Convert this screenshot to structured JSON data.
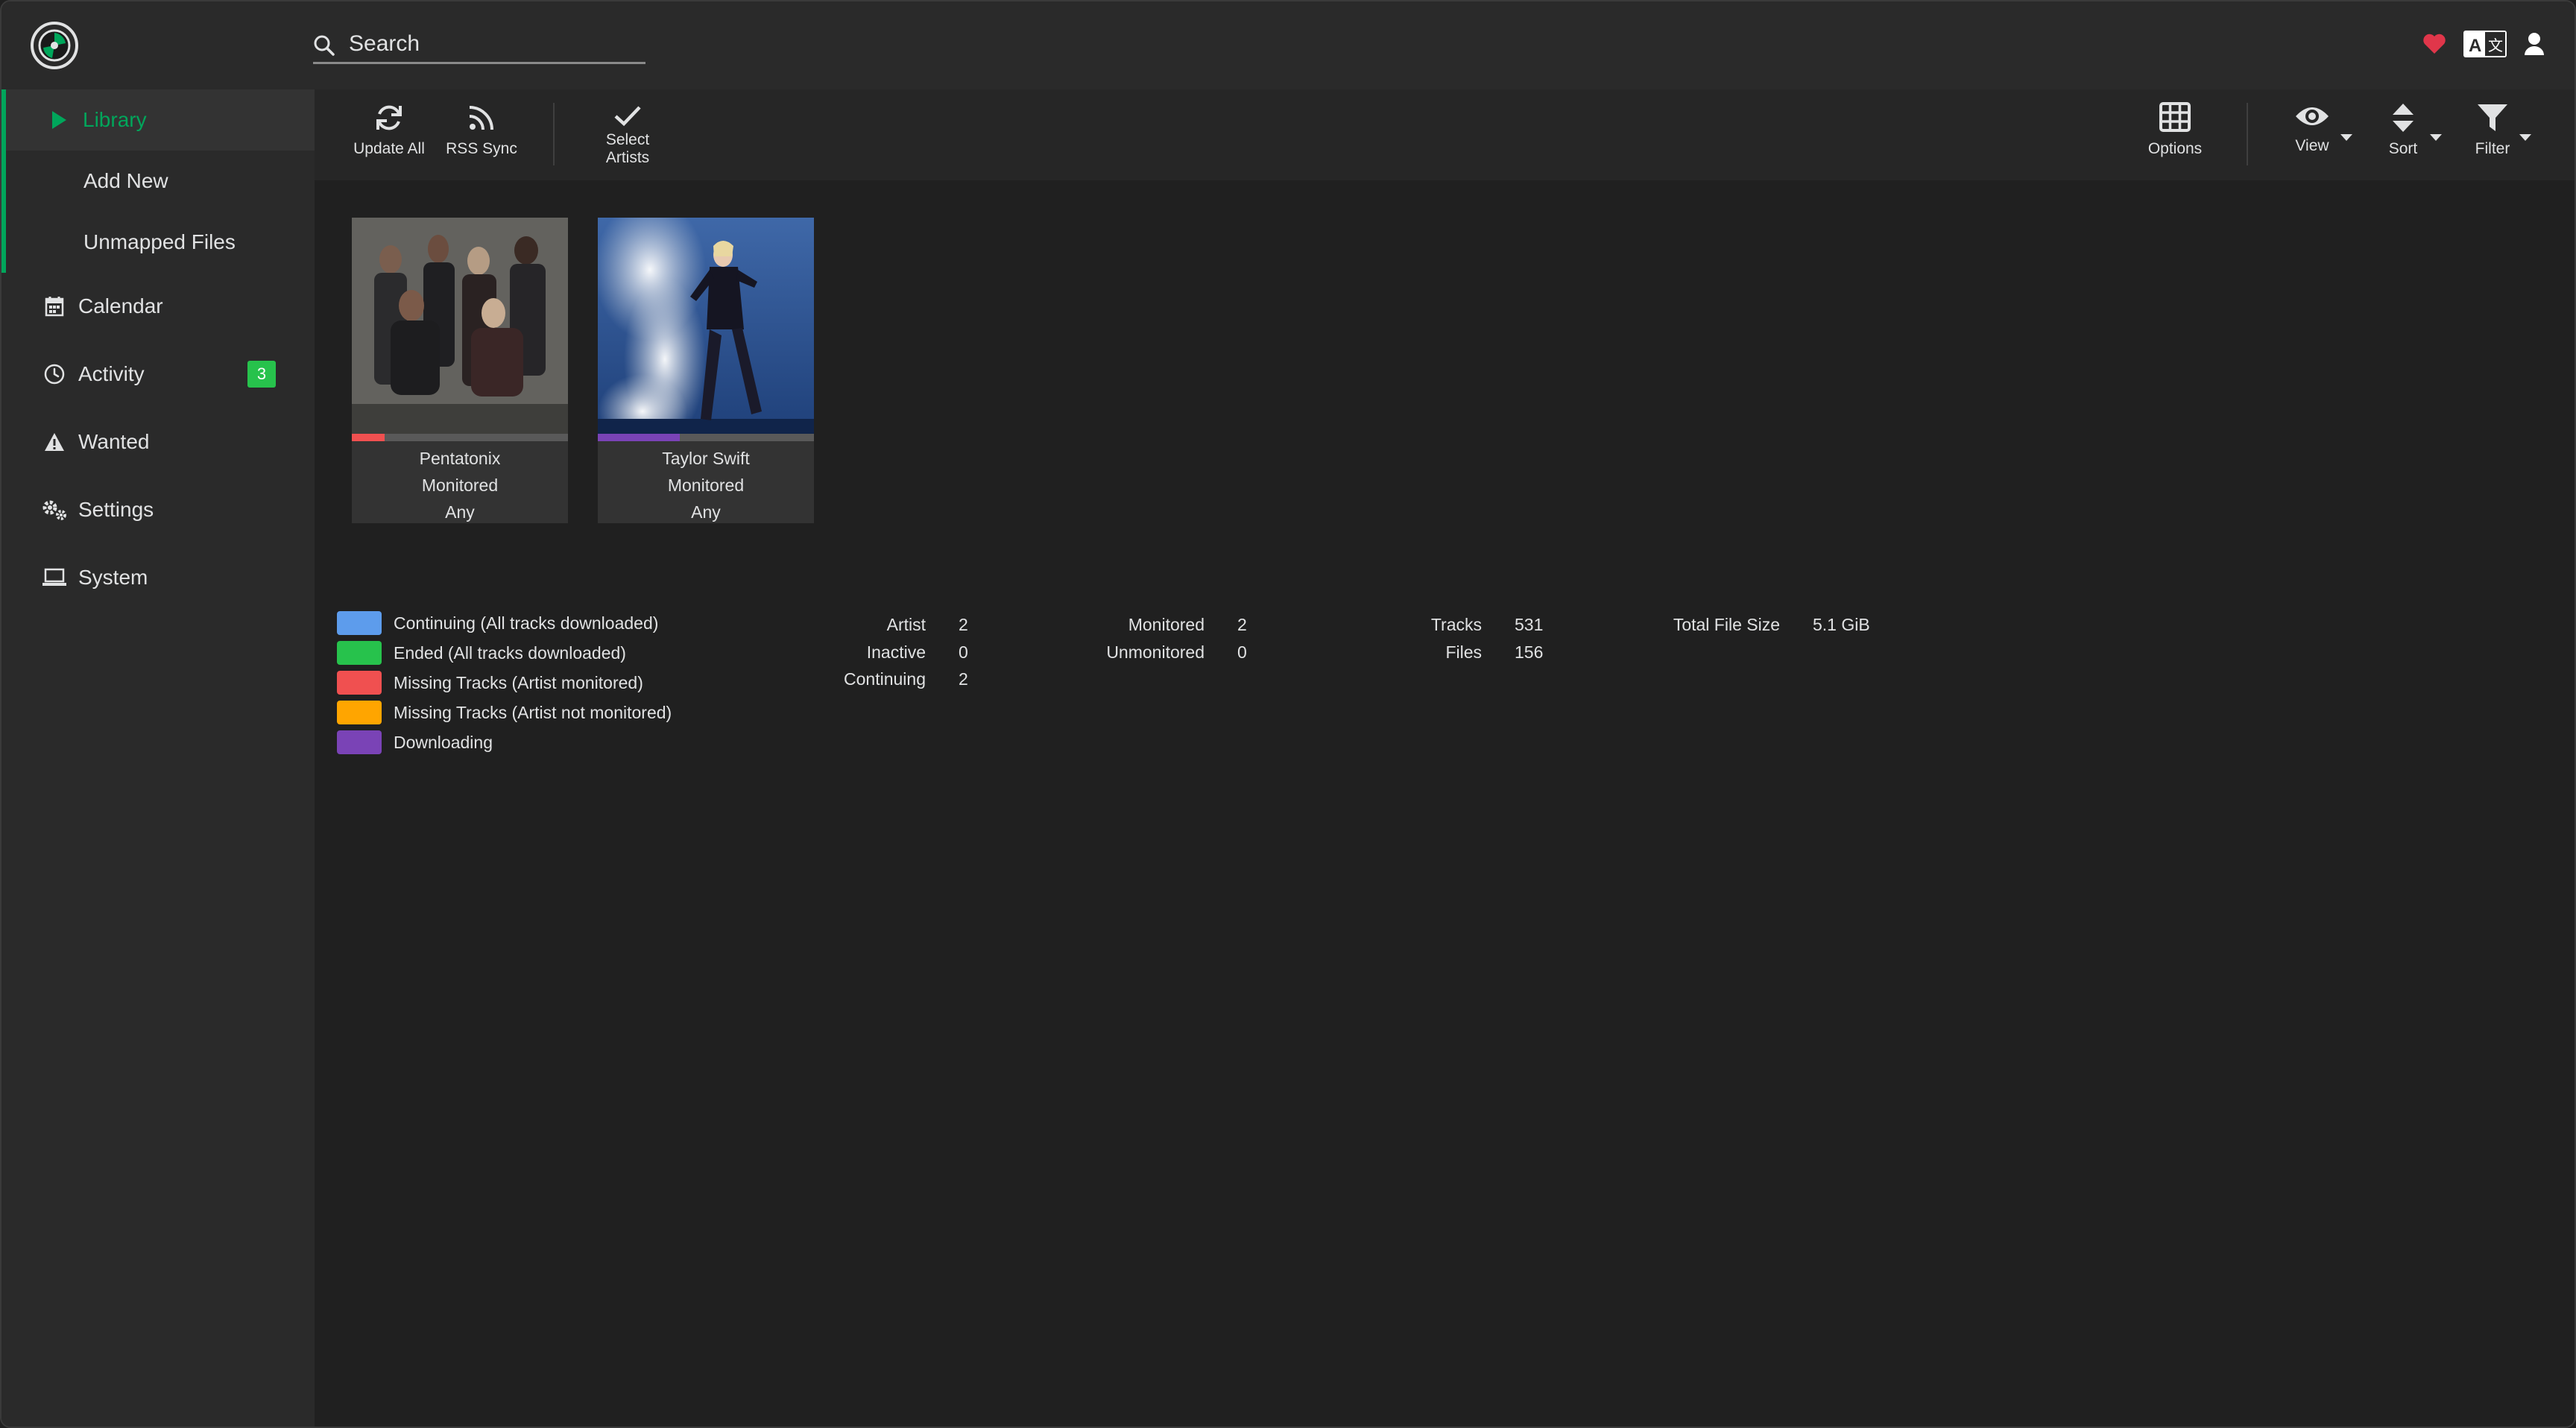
{
  "header": {
    "search_placeholder": "Search",
    "icons": [
      "heart-icon",
      "translate-icon",
      "user-icon"
    ]
  },
  "sidebar": {
    "items": [
      {
        "label": "Library",
        "icon": "play-icon",
        "active": true
      },
      {
        "label": "Add New"
      },
      {
        "label": "Unmapped Files"
      },
      {
        "label": "Calendar",
        "icon": "calendar-icon"
      },
      {
        "label": "Activity",
        "icon": "clock-icon",
        "badge": "3"
      },
      {
        "label": "Wanted",
        "icon": "warning-icon"
      },
      {
        "label": "Settings",
        "icon": "cogs-icon"
      },
      {
        "label": "System",
        "icon": "laptop-icon"
      }
    ]
  },
  "toolbar": {
    "update_all": "Update All",
    "rss_sync": "RSS Sync",
    "select_artists_line1": "Select",
    "select_artists_line2": "Artists",
    "options": "Options",
    "view": "View",
    "sort": "Sort",
    "filter": "Filter"
  },
  "artists": [
    {
      "name": "Pentatonix",
      "status": "Monitored",
      "quality": "Any",
      "bar_color": "#f05050",
      "progress": 0.15
    },
    {
      "name": "Taylor Swift",
      "status": "Monitored",
      "quality": "Any",
      "bar_color": "#7a43b6",
      "progress": 0.38
    }
  ],
  "legend": [
    {
      "label": "Continuing (All tracks downloaded)",
      "color": "#5d9cec"
    },
    {
      "label": "Ended (All tracks downloaded)",
      "color": "#27c24c"
    },
    {
      "label": "Missing Tracks (Artist monitored)",
      "color": "#f05050"
    },
    {
      "label": "Missing Tracks (Artist not monitored)",
      "color": "#ffa500"
    },
    {
      "label": "Downloading",
      "color": "#7a43b6"
    }
  ],
  "stats": {
    "artist_label": "Artist",
    "artist_value": "2",
    "inactive_label": "Inactive",
    "inactive_value": "0",
    "continuing_label": "Continuing",
    "continuing_value": "2",
    "monitored_label": "Monitored",
    "monitored_value": "2",
    "unmonitored_label": "Unmonitored",
    "unmonitored_value": "0",
    "tracks_label": "Tracks",
    "tracks_value": "531",
    "files_label": "Files",
    "files_value": "156",
    "total_size_label": "Total File Size",
    "total_size_value": "5.1 GiB"
  },
  "colors": {
    "accent": "#00a65b",
    "badge": "#27c24c",
    "heart": "#e0364a"
  }
}
